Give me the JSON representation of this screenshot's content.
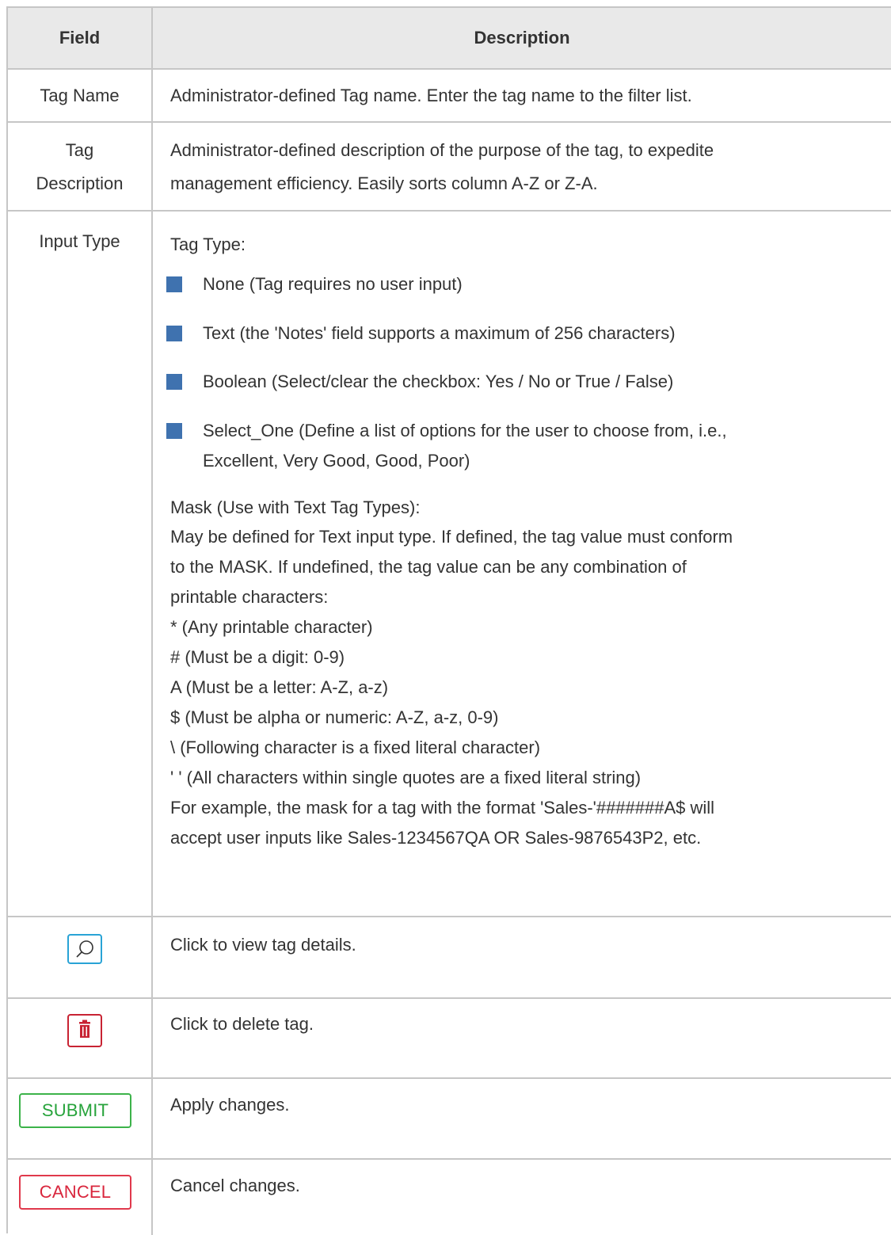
{
  "table": {
    "headers": {
      "field": "Field",
      "description": "Description"
    },
    "rows": {
      "tag_name": {
        "field": "Tag Name",
        "description": "Administrator-defined Tag name. Enter the tag name to the filter list."
      },
      "tag_description": {
        "field_line1": "Tag",
        "field_line2": "Description",
        "desc_line1": "Administrator-defined description of the purpose of the tag, to expedite",
        "desc_line2": "management efficiency. Easily sorts column A-Z or Z-A."
      },
      "input_type": {
        "field": "Input Type",
        "tag_type_label": "Tag Type:",
        "types": [
          "None (Tag requires no user input)",
          "Text (the 'Notes' field supports a maximum of 256 characters)",
          "Boolean (Select/clear the checkbox: Yes / No or True / False)",
          "Select_One (Define a list of options for the user to choose from, i.e.,",
          "Excellent, Very Good, Good, Poor)"
        ],
        "mask_title": "Mask (Use with Text Tag Types):",
        "mask_lines": [
          "May be defined for Text input type. If defined, the tag value must conform",
          "to the MASK. If undefined, the tag value can be any combination of",
          "printable characters:",
          "*  (Any printable character)",
          "#  (Must be a digit: 0-9)",
          "A  (Must be a letter: A-Z, a-z)",
          "$  (Must be alpha or numeric: A-Z, a-z, 0-9)",
          "\\  (Following character is a fixed literal character)",
          "' ' (All characters within single quotes are a fixed literal string)",
          "For example, the mask for a tag with the format 'Sales-'#######A$ will",
          "accept user inputs like Sales-1234567QA OR Sales-9876543P2, etc."
        ]
      },
      "search": {
        "icon": "search-icon",
        "description": "Click to view tag details."
      },
      "delete": {
        "icon": "trash-icon",
        "description": "Click to delete tag."
      },
      "submit": {
        "label": "SUBMIT",
        "description": "Apply changes."
      },
      "cancel": {
        "label": "CANCEL",
        "description": "Cancel changes."
      }
    }
  },
  "colors": {
    "border": "#c6c6c6",
    "header_bg": "#e9e9e9",
    "bullet": "#3f72af",
    "search_border": "#29a3d6",
    "delete": "#c82333",
    "submit": "#3cb34a",
    "cancel": "#e0394c"
  }
}
